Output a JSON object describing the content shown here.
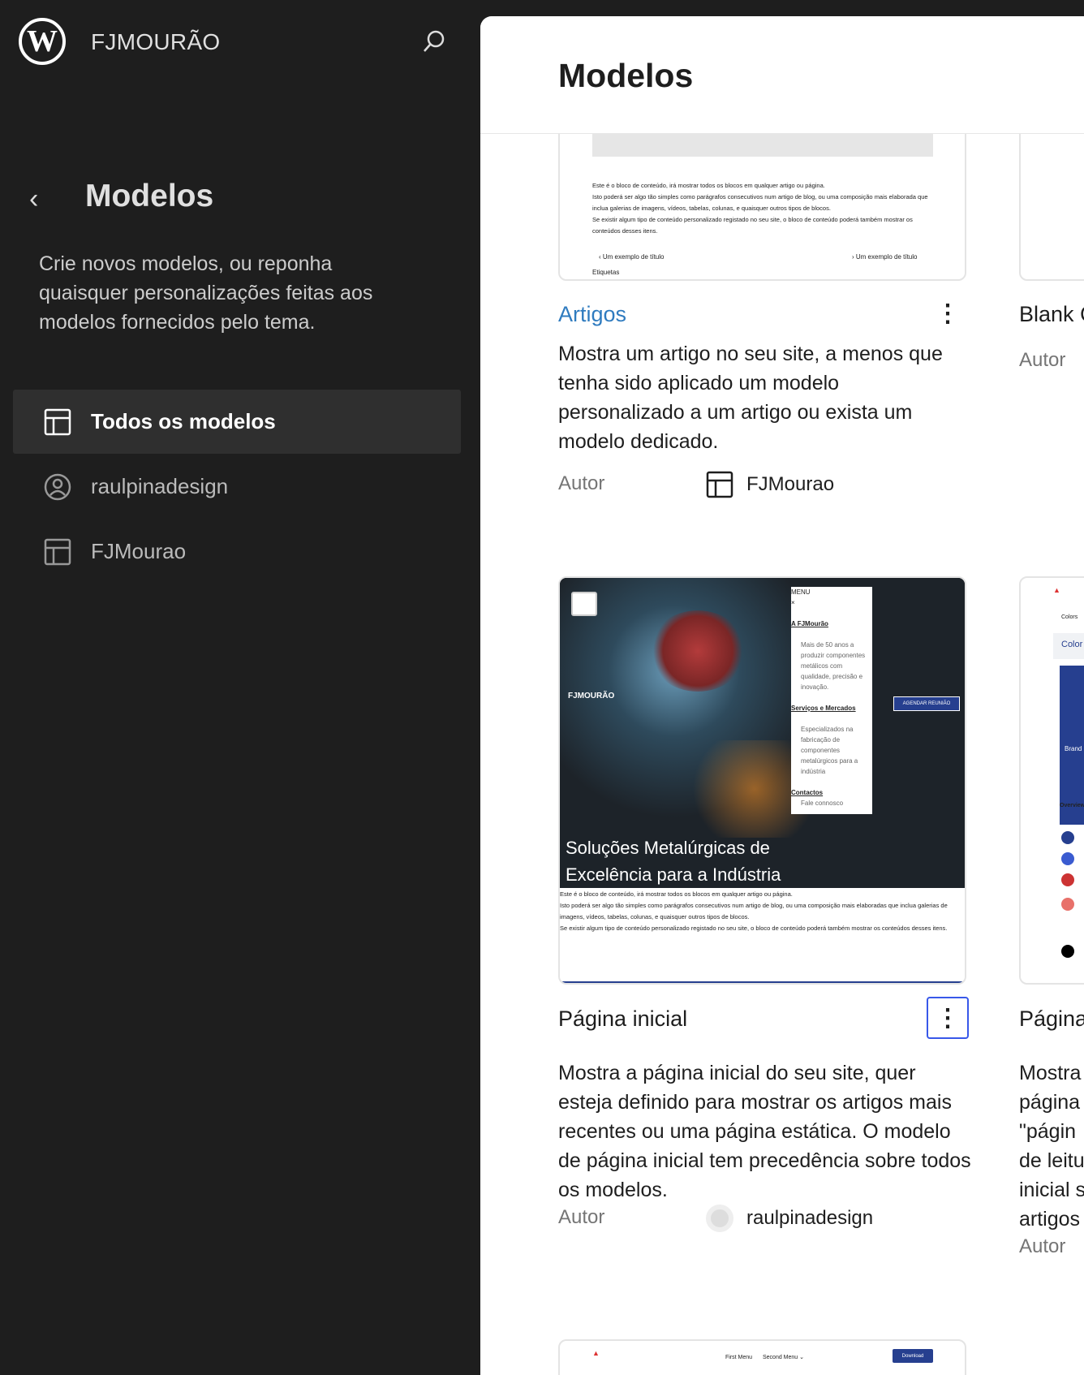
{
  "site": {
    "title": "FJMOURÃO",
    "logo": "wordpress-logo"
  },
  "sidebar": {
    "back_icon": "chevron-left-icon",
    "title": "Modelos",
    "description": "Crie novos modelos, ou reponha quaisquer personalizações feitas aos modelos fornecidos pelo tema.",
    "items": [
      {
        "label": "Todos os modelos",
        "icon": "layout-icon",
        "active": true
      },
      {
        "label": "raulpinadesign",
        "icon": "user-icon",
        "active": false
      },
      {
        "label": "FJMourao",
        "icon": "layout-icon",
        "active": false
      }
    ]
  },
  "main": {
    "title": "Modelos",
    "author_label": "Autor",
    "cards": [
      {
        "title": "Artigos",
        "description": "Mostra um artigo no seu site, a menos que tenha sido aplicado um modelo personalizado a um artigo ou exista um modelo dedicado.",
        "author": "FJMourao",
        "preview": {
          "text": [
            "Este é o bloco de conteúdo, irá mostrar todos os blocos em qualquer artigo ou página.",
            "Isto poderá ser algo tão simples como parágrafos consecutivos num artigo de blog, ou uma composição mais elaborada que inclua galerias de imagens, vídeos, tabelas, colunas, e quaisquer outros tipos de blocos.",
            "Se existir algum tipo de conteúdo personalizado registado no seu site, o bloco de conteúdo poderá também mostrar os conteúdos desses itens."
          ],
          "prev_link": "Um exemplo de título",
          "next_link": "Um exemplo de título",
          "tags": "Etiquetas"
        }
      },
      {
        "title": "Página inicial",
        "description": "Mostra a página inicial do seu site, quer esteja definido para mostrar os artigos mais recentes ou uma página estática. O modelo de página inicial tem precedência sobre todos os modelos.",
        "author": "raulpinadesign",
        "preview": {
          "menu": "MENU",
          "brand": "FJMOURÃO",
          "menu_items": [
            "A FJMourão",
            "Mais de 50 anos a produzir componentes metálicos com qualidade, precisão e inovação.",
            "Serviços e Mercados",
            "Especializados na fabricação de componentes metalúrgicos para a indústria",
            "Contactos",
            "Fale connosco"
          ],
          "cta": "AGENDAR REUNIÃO",
          "hero": "Soluções Metalúrgicas de Excelência para a Indústria",
          "text": [
            "Este é o bloco de conteúdo, irá mostrar todos os blocos em qualquer artigo ou página.",
            "Isto poderá ser algo tão simples como parágrafos consecutivos num artigo de blog, ou uma composição mais elaboradas que inclua galerias de imagens, vídeos, tabelas, colunas, e quaisquer outros tipos de blocos.",
            "Se existir algum tipo de conteúdo personalizado registado no seu site, o bloco de conteúdo poderá também mostrar os conteúdos desses itens."
          ]
        }
      },
      {
        "preview": {
          "menu1": "First Menu",
          "menu2": "Second Menu ⌄",
          "button": "Download"
        }
      }
    ],
    "right_cards": [
      {
        "title": "Blank C"
      },
      {
        "title": "Página",
        "description_lines": [
          "Mostra",
          "página",
          "\"págin",
          "de leitu",
          "inicial s",
          "artigos"
        ],
        "preview": {
          "tab": "Colors",
          "heading": "Color",
          "brand": "Brand",
          "overview": "Overview"
        }
      }
    ]
  },
  "colors": {
    "accent": "#3858e9",
    "link": "#2f7bbf",
    "navy": "#263f8f"
  }
}
